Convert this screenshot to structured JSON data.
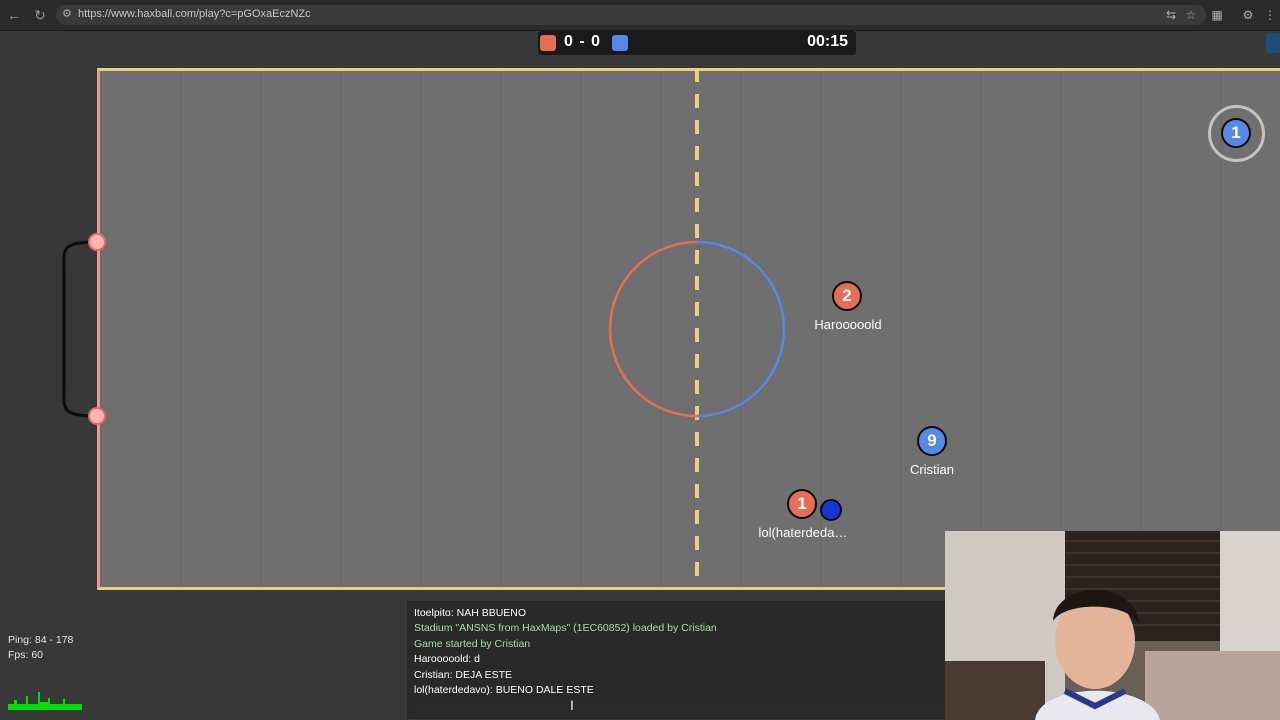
{
  "browser": {
    "url": "https://www.haxball.com/play?c=pGOxaEczNZc",
    "back_icon": "back-arrow-icon",
    "reload_icon": "reload-icon"
  },
  "scoreboard": {
    "red_score": "0",
    "separator": "-",
    "blue_score": "0",
    "timer": "00:15",
    "red_color": "#e56e56",
    "blue_color": "#5689e5"
  },
  "players": [
    {
      "number": "2",
      "name": "Harooooold",
      "team": "red"
    },
    {
      "number": "9",
      "name": "Cristian",
      "team": "blue"
    },
    {
      "number": "1",
      "name": "lol(haterdeda…",
      "team": "red"
    },
    {
      "number": "1",
      "name": "",
      "team": "blue"
    }
  ],
  "chat": {
    "lines": [
      {
        "text": "Itoelpito: NAH BBUENO",
        "type": "player"
      },
      {
        "text": "Stadium \"ANSNS from HaxMaps\" (1EC60852) loaded by Cristian",
        "type": "system"
      },
      {
        "text": "Game started by Cristian",
        "type": "system"
      },
      {
        "text": "Harooooold: d",
        "type": "player"
      },
      {
        "text": "Cristian: DEJA ESTE",
        "type": "player"
      },
      {
        "text": "lol(haterdedavo): BUENO DALE ESTE",
        "type": "player"
      }
    ]
  },
  "stats": {
    "ping": "Ping: 84 - 178",
    "fps": "Fps: 60"
  }
}
